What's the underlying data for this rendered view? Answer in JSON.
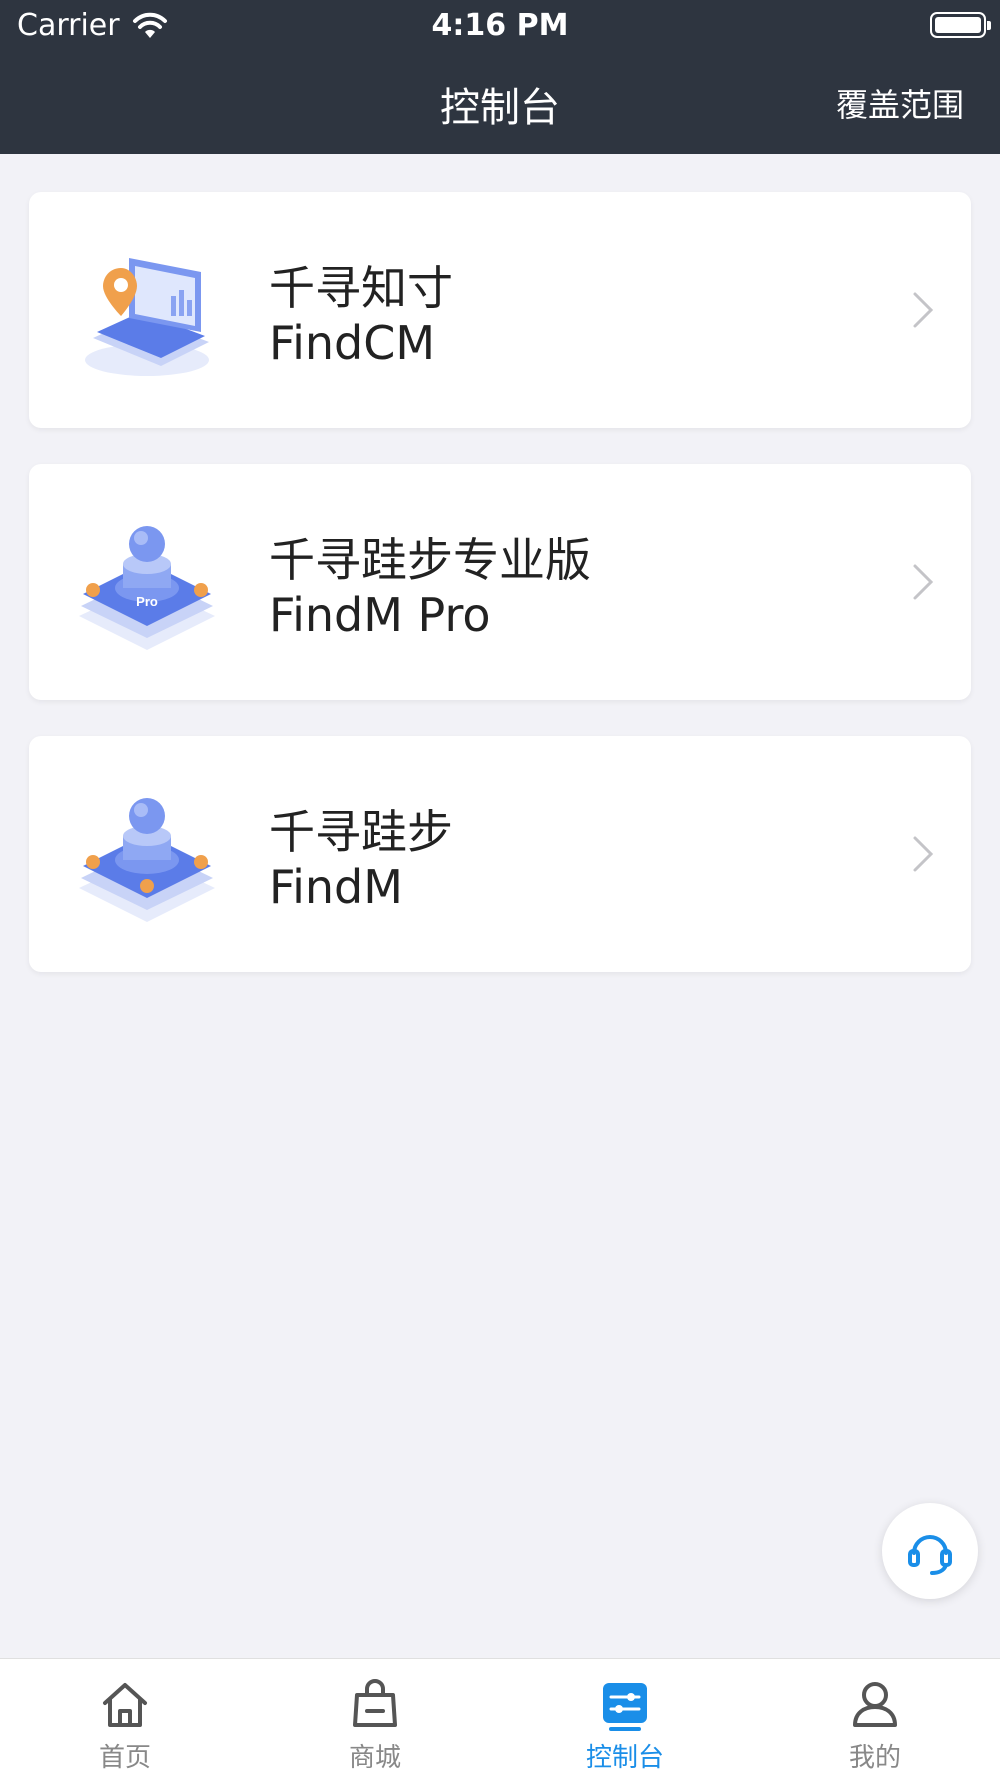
{
  "status_bar": {
    "carrier": "Carrier",
    "time": "4:16 PM"
  },
  "nav": {
    "title": "控制台",
    "right_action": "覆盖范围"
  },
  "cards": [
    {
      "title": "千寻知寸",
      "subtitle": "FindCM",
      "icon": "laptop-location-icon"
    },
    {
      "title": "千寻跬步专业版",
      "subtitle": "FindM Pro",
      "icon": "platform-pro-icon",
      "badge": "Pro"
    },
    {
      "title": "千寻跬步",
      "subtitle": "FindM",
      "icon": "platform-icon"
    }
  ],
  "fab": {
    "icon": "headset-icon"
  },
  "tabs": [
    {
      "label": "首页",
      "icon": "home-icon",
      "active": false
    },
    {
      "label": "商城",
      "icon": "shopping-bag-icon",
      "active": false
    },
    {
      "label": "控制台",
      "icon": "console-icon",
      "active": true
    },
    {
      "label": "我的",
      "icon": "user-icon",
      "active": false
    }
  ],
  "colors": {
    "header_bg": "#2e3540",
    "page_bg": "#f2f2f7",
    "accent": "#1a8ee8",
    "tab_inactive": "#888888"
  }
}
